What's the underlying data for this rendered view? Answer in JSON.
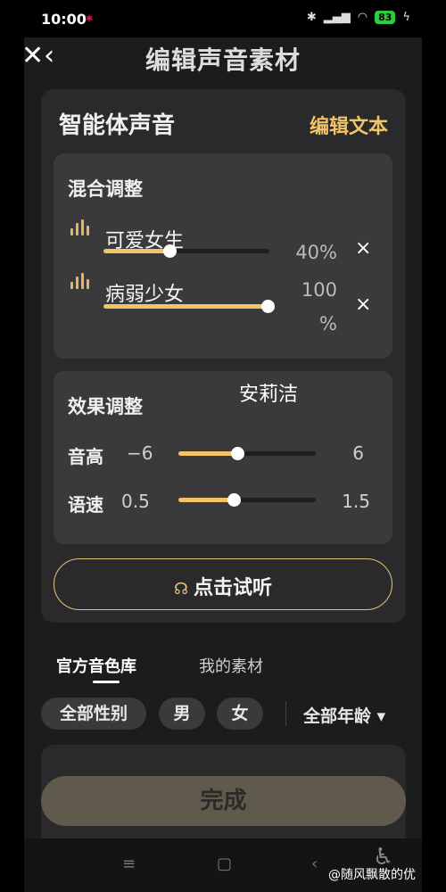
{
  "status_bar": {
    "time": "10:00",
    "battery": "83"
  },
  "header": {
    "close_back": "✕‹",
    "title": "编辑声音素材"
  },
  "agent_voice": {
    "title": "智能体声音",
    "edit_text_label": "编辑文本",
    "mix": {
      "title": "混合调整",
      "voices": [
        {
          "name": "可爱女生",
          "percent_text": "40%",
          "percent": 40
        },
        {
          "name": "病弱少女",
          "percent_text": "100\n%",
          "percent": 100
        }
      ],
      "remove_icon": "×"
    },
    "overlay_name": "安莉洁",
    "effects": {
      "title": "效果调整",
      "pitch": {
        "label": "音高",
        "min": "−6",
        "max": "6",
        "fill_fraction": 0.43
      },
      "speed": {
        "label": "语速",
        "min": "0.5",
        "max": "1.5",
        "fill_fraction": 0.4
      }
    },
    "listen_button": {
      "icon": "headphones-icon",
      "label": "点击试听"
    }
  },
  "tabs": [
    {
      "label": "官方音色库",
      "active": true
    },
    {
      "label": "我的素材",
      "active": false
    }
  ],
  "filters": {
    "gender": [
      "全部性别",
      "男",
      "女"
    ],
    "age": "全部年龄 ▾"
  },
  "done_button": {
    "label": "完成"
  },
  "nav": {
    "menu": "≡",
    "home": "▢",
    "back": "‹"
  },
  "watermark": "@随风飘散的优",
  "colors": {
    "accent": "#f2c468",
    "background": "#1c1c1e",
    "card": "#2a2a2d",
    "panel": "#3a3a3d"
  }
}
